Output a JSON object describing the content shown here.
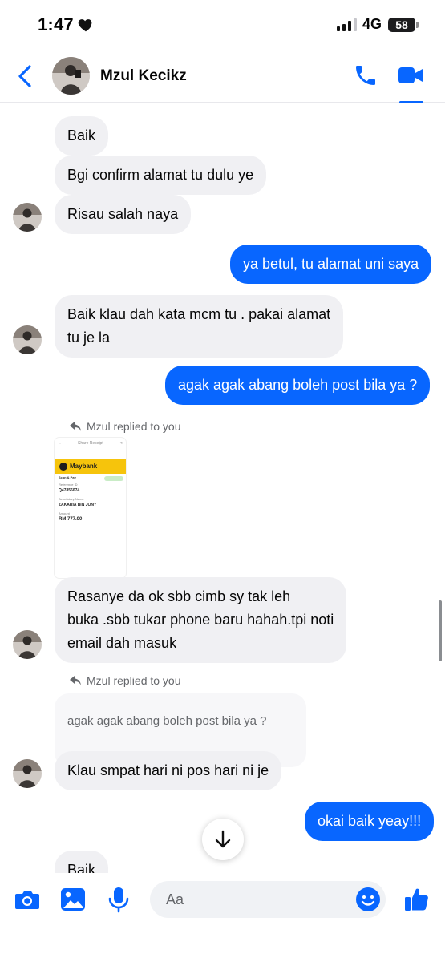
{
  "status_bar": {
    "time": "1:47",
    "network": "4G",
    "battery": "58"
  },
  "header": {
    "contact_name": "Mzul Kecikz"
  },
  "messages": [
    {
      "text": "Baik"
    },
    {
      "text": "Bgi confirm alamat tu dulu ye"
    },
    {
      "text": "Risau salah naya"
    },
    {
      "text": "ya betul, tu alamat uni saya"
    },
    {
      "line1": "Baik klau dah kata mcm tu . pakai alamat",
      "line2": "tu je la"
    },
    {
      "text": "agak agak abang boleh post bila ya ?"
    },
    {
      "reply_label": "Mzul replied to you"
    },
    {
      "line1": "Rasanye da ok sbb cimb sy tak leh",
      "line2": "buka .sbb tukar phone baru hahah.tpi noti",
      "line3": "email dah masuk"
    },
    {
      "reply_label": "Mzul replied to you",
      "quoted": "agak agak abang boleh post bila ya ?"
    },
    {
      "text": "Klau smpat hari ni pos hari ni je"
    },
    {
      "text": "okai baik yeay!!!"
    },
    {
      "text": "Baik"
    }
  ],
  "receipt": {
    "header": "Share Receipt",
    "bank": "Maybank",
    "tab": "Scan & Pay",
    "ref_label": "Reference ID",
    "ref_value": "Q47856074",
    "benef_label": "Beneficiary Name",
    "benef_value": "ZAKARIA BIN JONY",
    "amount_label": "Amount",
    "amount_value": "RM 777.00"
  },
  "composer": {
    "placeholder": "Aa"
  },
  "colors": {
    "accent": "#0866ff",
    "incoming_bubble": "#f0f0f3",
    "outgoing_bubble": "#0866ff"
  }
}
